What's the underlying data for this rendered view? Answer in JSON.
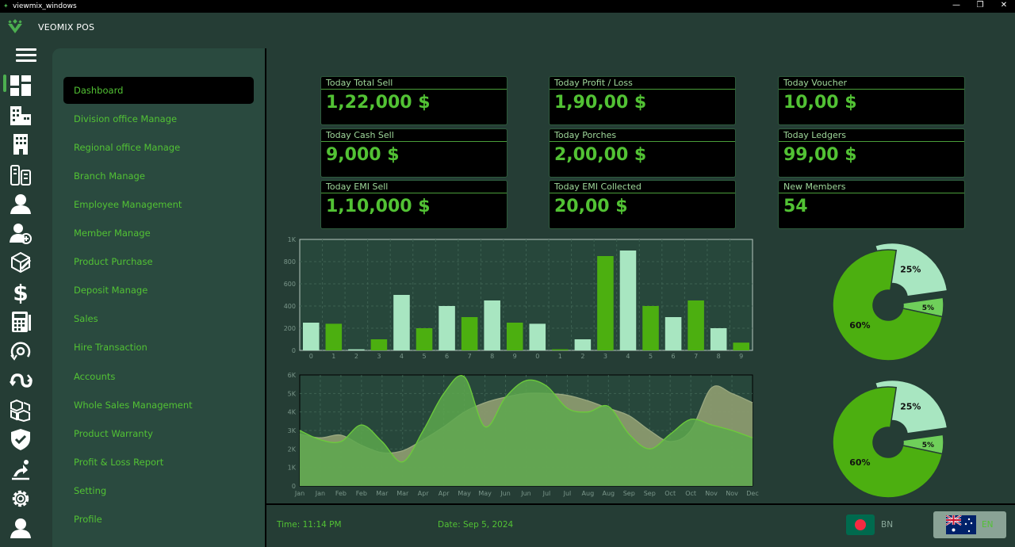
{
  "window": {
    "title": "viewmix_windows",
    "minimize": "—",
    "restore": "❐",
    "close": "✕"
  },
  "app": {
    "name": "VEOMIX POS"
  },
  "icon_rail": [
    "dashboard-icon",
    "building-icon",
    "office-building-icon",
    "branch-icon",
    "employee-icon",
    "add-member-icon",
    "product-purchase-icon",
    "dollar-icon",
    "calculator-icon",
    "hire-transaction-icon",
    "accounts-icon",
    "wholesale-boxes-icon",
    "shield-check-icon",
    "profit-loss-icon",
    "gear-icon",
    "profile-icon"
  ],
  "menu": [
    {
      "label": "Dashboard",
      "active": true
    },
    {
      "label": "Division office Manage"
    },
    {
      "label": "Regional office Manage"
    },
    {
      "label": "Branch Manage"
    },
    {
      "label": "Employee Management"
    },
    {
      "label": "Member Manage"
    },
    {
      "label": "Product Purchase"
    },
    {
      "label": "Deposit Manage"
    },
    {
      "label": "Sales"
    },
    {
      "label": "Hire Transaction"
    },
    {
      "label": "Accounts"
    },
    {
      "label": "Whole Sales Management"
    },
    {
      "label": "Product Warranty"
    },
    {
      "label": "Profit & Loss Report"
    },
    {
      "label": "Setting"
    },
    {
      "label": "Profile"
    }
  ],
  "cards": [
    {
      "label": "Today Total Sell",
      "value": "1,22,000  $"
    },
    {
      "label": "Today Profit / Loss",
      "value": "1,90,00  $"
    },
    {
      "label": "Today Voucher",
      "value": "10,00  $"
    },
    {
      "label": "Today Cash Sell",
      "value": "9,000  $"
    },
    {
      "label": "Today Porches",
      "value": "2,00,00  $"
    },
    {
      "label": "Today Ledgers",
      "value": "99,00  $"
    },
    {
      "label": "Today EMI Sell",
      "value": "1,10,000  $"
    },
    {
      "label": "Today EMI Collected",
      "value": "20,00  $"
    },
    {
      "label": "New Members",
      "value": "54"
    }
  ],
  "chart_data": [
    {
      "type": "bar",
      "categories": [
        "0",
        "1",
        "2",
        "3",
        "4",
        "5",
        "6",
        "7",
        "8",
        "9",
        "0",
        "1",
        "2",
        "3",
        "4",
        "5",
        "6",
        "7",
        "8",
        "9"
      ],
      "values": [
        250,
        240,
        10,
        100,
        500,
        200,
        400,
        300,
        450,
        250,
        240,
        10,
        100,
        850,
        900,
        400,
        300,
        450,
        200,
        70
      ],
      "colors": [
        "#a8e6c1",
        "#4caf10",
        "#a8e6c1",
        "#4caf10",
        "#a8e6c1",
        "#4caf10",
        "#a8e6c1",
        "#4caf10",
        "#a8e6c1",
        "#4caf10",
        "#a8e6c1",
        "#4caf10",
        "#a8e6c1",
        "#4caf10",
        "#a8e6c1",
        "#4caf10",
        "#a8e6c1",
        "#4caf10",
        "#a8e6c1",
        "#4caf10"
      ],
      "yticks": [
        "0",
        "200",
        "400",
        "600",
        "800",
        "1K"
      ],
      "ylim": [
        0,
        1000
      ],
      "grid": true
    },
    {
      "type": "area",
      "categories": [
        "Jan",
        "Jan",
        "Feb",
        "Feb",
        "Mar",
        "Mar",
        "Apr",
        "Apr",
        "May",
        "May",
        "Jun",
        "Jun",
        "Jul",
        "Jul",
        "Aug",
        "Aug",
        "Sep",
        "Sep",
        "Oct",
        "Oct",
        "Nov",
        "Nov",
        "Dec"
      ],
      "series": [
        {
          "values": [
            2800,
            2600,
            2750,
            2200,
            1800,
            1900,
            2500,
            3200,
            4000,
            4500,
            4800,
            5000,
            5000,
            4900,
            4600,
            4200,
            3800,
            3000,
            2400,
            3000,
            5300,
            5000,
            4500
          ],
          "color": "#8a9a6e"
        },
        {
          "values": [
            3000,
            2500,
            2400,
            3300,
            2400,
            1300,
            3000,
            5000,
            5900,
            3200,
            4800,
            5700,
            5400,
            4200,
            4000,
            4300,
            2800,
            2000,
            2800,
            3600,
            3300,
            3000,
            2600
          ],
          "color": "#5da84e"
        }
      ],
      "yticks": [
        "0",
        "1K",
        "2K",
        "3K",
        "4K",
        "5K",
        "6K"
      ],
      "ylim": [
        0,
        6000
      ],
      "grid": true
    },
    {
      "type": "pie",
      "slices": [
        {
          "label": "25%",
          "value": 25,
          "color": "#a8e6c1"
        },
        {
          "label": "5%",
          "value": 5,
          "color": "#6fcf5a"
        },
        {
          "label": "60%",
          "value": 60,
          "color": "#4caf10"
        }
      ]
    },
    {
      "type": "pie",
      "slices": [
        {
          "label": "25%",
          "value": 25,
          "color": "#a8e6c1"
        },
        {
          "label": "5%",
          "value": 5,
          "color": "#6fcf5a"
        },
        {
          "label": "60%",
          "value": 60,
          "color": "#4caf10"
        }
      ]
    }
  ],
  "footer": {
    "time": "Time: 11:14 PM",
    "date": "Date: Sep 5, 2024",
    "lang_bn": "BN",
    "lang_en": "EN"
  }
}
